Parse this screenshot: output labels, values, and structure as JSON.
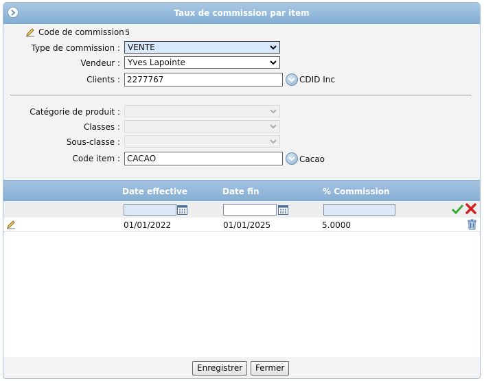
{
  "window": {
    "title": "Taux de commission par item"
  },
  "form": {
    "code_commission": {
      "label": "Code de commission :",
      "value": "5"
    },
    "type_commission": {
      "label": "Type de commission :",
      "value": "VENTE"
    },
    "vendeur": {
      "label": "Vendeur :",
      "value": "Yves Lapointe"
    },
    "clients": {
      "label": "Clients :",
      "value": "2277767",
      "name": "CDID Inc"
    },
    "categorie": {
      "label": "Catégorie de produit :",
      "value": ""
    },
    "classes": {
      "label": "Classes :",
      "value": ""
    },
    "sous_classe": {
      "label": "Sous-classe :",
      "value": ""
    },
    "code_item": {
      "label": "Code item :",
      "value": "CACAO",
      "name": "Cacao"
    }
  },
  "grid": {
    "columns": [
      "Date effective",
      "Date fin",
      "% Commission"
    ],
    "filter": {
      "date_effective": "",
      "date_fin": "",
      "commission": ""
    },
    "rows": [
      {
        "date_effective": "01/01/2022",
        "date_fin": "01/01/2025",
        "commission": "5.0000"
      }
    ]
  },
  "buttons": {
    "save": "Enregistrer",
    "close": "Fermer"
  },
  "icons": {
    "title": "arrow-circle-icon",
    "edit": "pencil-icon",
    "lookup": "chevron-circle-icon",
    "calendar": "calendar-icon",
    "confirm": "check-icon",
    "cancel": "x-icon",
    "delete": "trash-icon"
  },
  "colors": {
    "accent": "#8db4d9",
    "check": "#3aa83a",
    "cross": "#d32020"
  }
}
